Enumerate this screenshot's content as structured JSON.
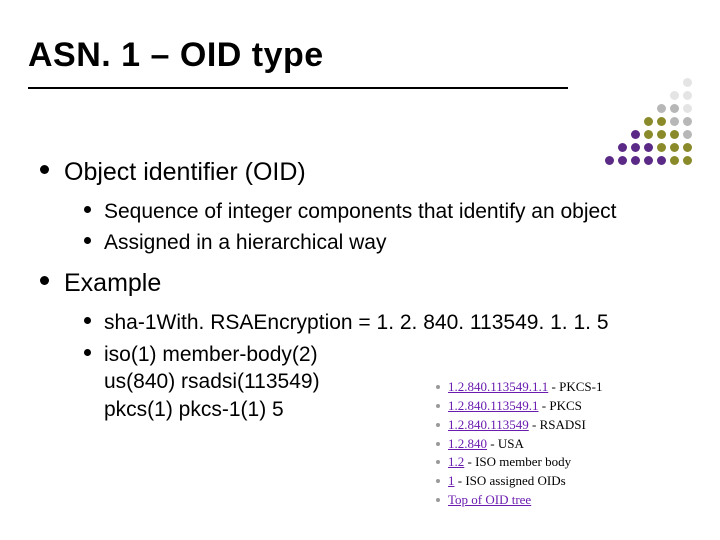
{
  "title": "ASN. 1 – OID type",
  "bullets": {
    "item1": {
      "label": "Object identifier (OID)",
      "sub1": "Sequence of integer components that identify an object",
      "sub2": "Assigned in a hierarchical way"
    },
    "item2": {
      "label": "Example",
      "sub1": "sha-1With. RSAEncryption = 1. 2. 840. 113549. 1. 1. 5",
      "sub2_line1": "iso(1) member-body(2)",
      "sub2_line2": "us(840) rsadsi(113549)",
      "sub2_line3": "pkcs(1) pkcs-1(1) 5"
    }
  },
  "oid_tree": [
    {
      "link": "1.2.840.113549.1.1",
      "desc": "PKCS-1"
    },
    {
      "link": "1.2.840.113549.1",
      "desc": "PKCS"
    },
    {
      "link": "1.2.840.113549",
      "desc": "RSADSI"
    },
    {
      "link": "1.2.840",
      "desc": "USA"
    },
    {
      "link": "1.2",
      "desc": "ISO member body"
    },
    {
      "link": "1",
      "desc": "ISO assigned OIDs"
    },
    {
      "link": "Top of OID tree",
      "desc": ""
    }
  ],
  "dot_colors": {
    "purple": "#5b2a86",
    "olive": "#8a8a2a",
    "grey": "#b7b7b7",
    "light": "#e4e4e4"
  }
}
